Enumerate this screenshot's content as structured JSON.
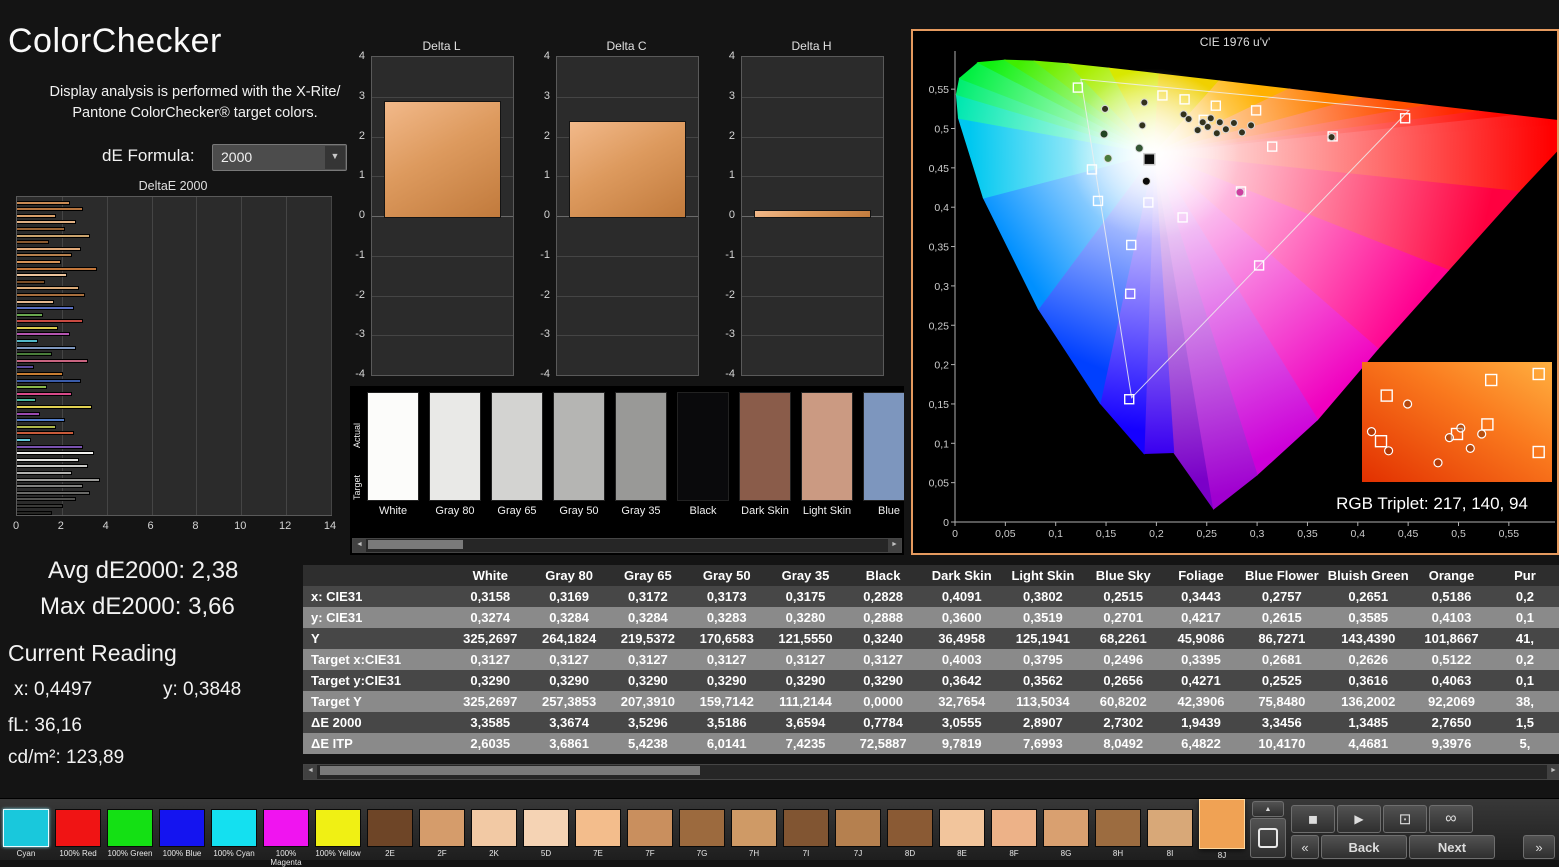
{
  "header": {
    "title": "ColorChecker",
    "description_line1": "Display analysis is performed with the X-Rite/",
    "description_line2": "Pantone ColorChecker® target colors.",
    "formula_label": "dE Formula:",
    "formula_value": "2000"
  },
  "icons": {
    "dropdown": "▼",
    "scroll_left": "◄",
    "scroll_right": "►",
    "up": "▲",
    "stop": "◼",
    "play": "▶",
    "pattern": "⊡",
    "loop": "∞",
    "prev": "«",
    "next": "»"
  },
  "chart_data": [
    {
      "id": "deltaE2000",
      "type": "bar",
      "orientation": "horizontal",
      "title": "DeltaE 2000",
      "xlim": [
        0,
        14
      ],
      "xticks": [
        0,
        2,
        4,
        6,
        8,
        10,
        12,
        14
      ],
      "bars": [
        {
          "value": 2.3,
          "color": "#c98a54"
        },
        {
          "value": 2.9,
          "color": "#b5743f"
        },
        {
          "value": 1.7,
          "color": "#d9a06a"
        },
        {
          "value": 2.6,
          "color": "#e2b184"
        },
        {
          "value": 2.1,
          "color": "#9c6434"
        },
        {
          "value": 3.2,
          "color": "#caa36d"
        },
        {
          "value": 1.4,
          "color": "#8a5a30"
        },
        {
          "value": 2.8,
          "color": "#e0a878"
        },
        {
          "value": 2.4,
          "color": "#b8814e"
        },
        {
          "value": 1.9,
          "color": "#d89458"
        },
        {
          "value": 3.5,
          "color": "#c2763a"
        },
        {
          "value": 2.2,
          "color": "#edc49c"
        },
        {
          "value": 1.2,
          "color": "#7c4f28"
        },
        {
          "value": 2.7,
          "color": "#d9a977"
        },
        {
          "value": 3.0,
          "color": "#a86f3e"
        },
        {
          "value": 1.6,
          "color": "#e6b88e"
        },
        {
          "value": 2.5,
          "color": "#5a6fc0"
        },
        {
          "value": 1.1,
          "color": "#6aa84f"
        },
        {
          "value": 2.9,
          "color": "#c84a42"
        },
        {
          "value": 1.8,
          "color": "#d8c84a"
        },
        {
          "value": 2.3,
          "color": "#b455b0"
        },
        {
          "value": 0.9,
          "color": "#52b8c8"
        },
        {
          "value": 2.6,
          "color": "#7d96be"
        },
        {
          "value": 1.5,
          "color": "#4a7d3a"
        },
        {
          "value": 3.1,
          "color": "#c86480"
        },
        {
          "value": 0.7,
          "color": "#5a4a9c"
        },
        {
          "value": 2.0,
          "color": "#c87d32"
        },
        {
          "value": 2.8,
          "color": "#3a5ba8"
        },
        {
          "value": 1.3,
          "color": "#8ab84a"
        },
        {
          "value": 2.4,
          "color": "#d84a8a"
        },
        {
          "value": 0.8,
          "color": "#4ab8a0"
        },
        {
          "value": 3.3,
          "color": "#e0d052"
        },
        {
          "value": 1.0,
          "color": "#9a4ab0"
        },
        {
          "value": 2.1,
          "color": "#527dc8"
        },
        {
          "value": 1.7,
          "color": "#b0b84a"
        },
        {
          "value": 2.5,
          "color": "#c85a3a"
        },
        {
          "value": 0.6,
          "color": "#62c8d8"
        },
        {
          "value": 2.9,
          "color": "#7a52b0"
        },
        {
          "value": 3.4,
          "color": "#f2f2f0"
        },
        {
          "value": 2.7,
          "color": "#e2e2e0"
        },
        {
          "value": 3.1,
          "color": "#cacac8"
        },
        {
          "value": 2.4,
          "color": "#b2b2b0"
        },
        {
          "value": 3.66,
          "color": "#9a9a98"
        },
        {
          "value": 2.9,
          "color": "#828280"
        },
        {
          "value": 3.2,
          "color": "#6a6a68"
        },
        {
          "value": 2.6,
          "color": "#525250"
        },
        {
          "value": 2.0,
          "color": "#3a3a38"
        },
        {
          "value": 1.5,
          "color": "#262624"
        }
      ]
    },
    {
      "id": "deltaL",
      "type": "bar",
      "title": "Delta L",
      "ylim": [
        -4,
        4
      ],
      "yticks": [
        4,
        3,
        2,
        1,
        0,
        -1,
        -2,
        -3,
        -4
      ],
      "value": 2.9
    },
    {
      "id": "deltaC",
      "type": "bar",
      "title": "Delta C",
      "ylim": [
        -4,
        4
      ],
      "yticks": [
        4,
        3,
        2,
        1,
        0,
        -1,
        -2,
        -3,
        -4
      ],
      "value": 2.4
    },
    {
      "id": "deltaH",
      "type": "bar",
      "title": "Delta H",
      "ylim": [
        -4,
        4
      ],
      "yticks": [
        4,
        3,
        2,
        1,
        0,
        -1,
        -2,
        -3,
        -4
      ],
      "value": 0.15
    },
    {
      "id": "cie",
      "type": "scatter",
      "title": "CIE 1976 u'v'",
      "xticks": [
        "0",
        "0,05",
        "0,1",
        "0,15",
        "0,2",
        "0,25",
        "0,3",
        "0,35",
        "0,4",
        "0,45",
        "0,5",
        "0,55"
      ],
      "yticks": [
        "0",
        "0,05",
        "0,1",
        "0,15",
        "0,2",
        "0,25",
        "0,3",
        "0,35",
        "0,4",
        "0,45",
        "0,5",
        "0,55"
      ],
      "rec709_triangle": [
        [
          0.4507,
          0.5229
        ],
        [
          0.125,
          0.5625
        ],
        [
          0.1754,
          0.1579
        ]
      ],
      "targets": [
        [
          0.122,
          0.552
        ],
        [
          0.206,
          0.542
        ],
        [
          0.228,
          0.537
        ],
        [
          0.259,
          0.529
        ],
        [
          0.299,
          0.523
        ],
        [
          0.447,
          0.513
        ],
        [
          0.375,
          0.49
        ],
        [
          0.315,
          0.477
        ],
        [
          0.136,
          0.448
        ],
        [
          0.142,
          0.408
        ],
        [
          0.192,
          0.406
        ],
        [
          0.226,
          0.387
        ],
        [
          0.284,
          0.42
        ],
        [
          0.302,
          0.326
        ],
        [
          0.175,
          0.352
        ],
        [
          0.174,
          0.29
        ],
        [
          0.173,
          0.156
        ],
        [
          0.247,
          0.511
        ]
      ],
      "measured": [
        [
          0.149,
          0.525
        ],
        [
          0.188,
          0.533
        ],
        [
          0.186,
          0.504
        ],
        [
          0.227,
          0.518
        ],
        [
          0.241,
          0.498
        ],
        [
          0.251,
          0.502
        ],
        [
          0.26,
          0.494
        ],
        [
          0.269,
          0.499
        ],
        [
          0.277,
          0.507
        ],
        [
          0.285,
          0.495
        ],
        [
          0.294,
          0.504
        ],
        [
          0.374,
          0.489
        ],
        [
          0.232,
          0.512
        ],
        [
          0.246,
          0.508
        ],
        [
          0.254,
          0.513
        ],
        [
          0.263,
          0.508
        ]
      ],
      "accents": [
        {
          "u": 0.283,
          "v": 0.419,
          "color": "#cc3fa0"
        },
        {
          "u": 0.19,
          "v": 0.433,
          "color": "#0a0a0a"
        },
        {
          "u": 0.148,
          "v": 0.493,
          "color": "#224422"
        },
        {
          "u": 0.183,
          "v": 0.475,
          "color": "#335533"
        },
        {
          "u": 0.152,
          "v": 0.462,
          "color": "#4a7a3a"
        }
      ],
      "special_square": {
        "u": 0.193,
        "v": 0.461
      },
      "inset_markers": {
        "squares": [
          [
            0.13,
            0.28
          ],
          [
            0.68,
            0.15
          ],
          [
            0.93,
            0.1
          ],
          [
            0.5,
            0.6
          ],
          [
            0.66,
            0.52
          ],
          [
            0.93,
            0.75
          ],
          [
            0.1,
            0.66
          ]
        ],
        "circles": [
          [
            0.24,
            0.35
          ],
          [
            0.05,
            0.58
          ],
          [
            0.14,
            0.74
          ],
          [
            0.46,
            0.63
          ],
          [
            0.57,
            0.72
          ],
          [
            0.63,
            0.6
          ],
          [
            0.4,
            0.84
          ],
          [
            0.52,
            0.55
          ]
        ]
      },
      "rgb_triplet": "RGB Triplet: 217, 140, 94"
    }
  ],
  "swatch_strip": {
    "row_label_top": "Actual",
    "row_label_bottom": "Target",
    "swatches": [
      {
        "label": "White",
        "color": "#fcfcfa"
      },
      {
        "label": "Gray 80",
        "color": "#e9e9e7"
      },
      {
        "label": "Gray 65",
        "color": "#d3d3d1"
      },
      {
        "label": "Gray 50",
        "color": "#b5b5b3"
      },
      {
        "label": "Gray 35",
        "color": "#999997"
      },
      {
        "label": "Black",
        "color": "#0a0a0c"
      },
      {
        "label": "Dark Skin",
        "color": "#8a5c4a"
      },
      {
        "label": "Light Skin",
        "color": "#cb9a82"
      },
      {
        "label": "Blue",
        "color": "#7d96be"
      }
    ]
  },
  "stats": {
    "avg": "Avg dE2000: 2,38",
    "max": "Max dE2000: 3,66",
    "current_reading": "Current Reading",
    "x": "x: 0,4497",
    "y": "y: 0,3848",
    "fl": "fL: 36,16",
    "cd": "cd/m²: 123,89"
  },
  "table": {
    "columns": [
      "White",
      "Gray 80",
      "Gray 65",
      "Gray 50",
      "Gray 35",
      "Black",
      "Dark Skin",
      "Light Skin",
      "Blue Sky",
      "Foliage",
      "Blue Flower",
      "Bluish Green",
      "Orange",
      "Pur"
    ],
    "rows": [
      {
        "label": "x: CIE31",
        "values": [
          "0,3158",
          "0,3169",
          "0,3172",
          "0,3173",
          "0,3175",
          "0,2828",
          "0,4091",
          "0,3802",
          "0,2515",
          "0,3443",
          "0,2757",
          "0,2651",
          "0,5186",
          "0,2"
        ]
      },
      {
        "label": "y: CIE31",
        "values": [
          "0,3274",
          "0,3284",
          "0,3284",
          "0,3283",
          "0,3280",
          "0,2888",
          "0,3600",
          "0,3519",
          "0,2701",
          "0,4217",
          "0,2615",
          "0,3585",
          "0,4103",
          "0,1"
        ]
      },
      {
        "label": "Y",
        "values": [
          "325,2697",
          "264,1824",
          "219,5372",
          "170,6583",
          "121,5550",
          "0,3240",
          "36,4958",
          "125,1941",
          "68,2261",
          "45,9086",
          "86,7271",
          "143,4390",
          "101,8667",
          "41,"
        ]
      },
      {
        "label": "Target x:CIE31",
        "values": [
          "0,3127",
          "0,3127",
          "0,3127",
          "0,3127",
          "0,3127",
          "0,3127",
          "0,4003",
          "0,3795",
          "0,2496",
          "0,3395",
          "0,2681",
          "0,2626",
          "0,5122",
          "0,2"
        ]
      },
      {
        "label": "Target y:CIE31",
        "values": [
          "0,3290",
          "0,3290",
          "0,3290",
          "0,3290",
          "0,3290",
          "0,3290",
          "0,3642",
          "0,3562",
          "0,2656",
          "0,4271",
          "0,2525",
          "0,3616",
          "0,4063",
          "0,1"
        ]
      },
      {
        "label": "Target Y",
        "values": [
          "325,2697",
          "257,3853",
          "207,3910",
          "159,7142",
          "111,2144",
          "0,0000",
          "32,7654",
          "113,5034",
          "60,8202",
          "42,3906",
          "75,8480",
          "136,2002",
          "92,2069",
          "38,"
        ]
      },
      {
        "label": "ΔE 2000",
        "values": [
          "3,3585",
          "3,3674",
          "3,5296",
          "3,5186",
          "3,6594",
          "0,7784",
          "3,0555",
          "2,8907",
          "2,7302",
          "1,9439",
          "3,3456",
          "1,3485",
          "2,7650",
          "1,5"
        ]
      },
      {
        "label": "ΔE ITP",
        "values": [
          "2,6035",
          "3,6861",
          "5,4238",
          "6,0141",
          "7,4235",
          "72,5887",
          "9,7819",
          "7,6993",
          "8,0492",
          "6,4822",
          "10,4170",
          "4,4681",
          "9,3976",
          "5,"
        ]
      }
    ]
  },
  "toolbar": {
    "back_label": "Back",
    "next_label": "Next",
    "patches": [
      {
        "label": "Cyan",
        "color": "#19c8dc",
        "highlight": true
      },
      {
        "label": "100% Red",
        "color": "#f01414"
      },
      {
        "label": "100% Green",
        "color": "#14e014"
      },
      {
        "label": "100% Blue",
        "color": "#1414f0"
      },
      {
        "label": "100% Cyan",
        "color": "#14e0f0"
      },
      {
        "label": "100% Magenta",
        "color": "#f014f0"
      },
      {
        "label": "100% Yellow",
        "color": "#f0f014"
      },
      {
        "label": "2E",
        "color": "#6e4527"
      },
      {
        "label": "2F",
        "color": "#d59c6b"
      },
      {
        "label": "2K",
        "color": "#f2c9a4"
      },
      {
        "label": "5D",
        "color": "#f5d3b4"
      },
      {
        "label": "7E",
        "color": "#f3bd8c"
      },
      {
        "label": "7F",
        "color": "#c98f5e"
      },
      {
        "label": "7G",
        "color": "#9c6a3e"
      },
      {
        "label": "7H",
        "color": "#cf9a66"
      },
      {
        "label": "7I",
        "color": "#815532"
      },
      {
        "label": "7J",
        "color": "#b5804f"
      },
      {
        "label": "8D",
        "color": "#8a5a34"
      },
      {
        "label": "8E",
        "color": "#f2c59c"
      },
      {
        "label": "8F",
        "color": "#edb288"
      },
      {
        "label": "8G",
        "color": "#d9a070"
      },
      {
        "label": "8H",
        "color": "#9c6c40"
      },
      {
        "label": "8I",
        "color": "#d8a878"
      },
      {
        "label": "8J",
        "color": "#f0a254",
        "selected": true
      }
    ]
  }
}
